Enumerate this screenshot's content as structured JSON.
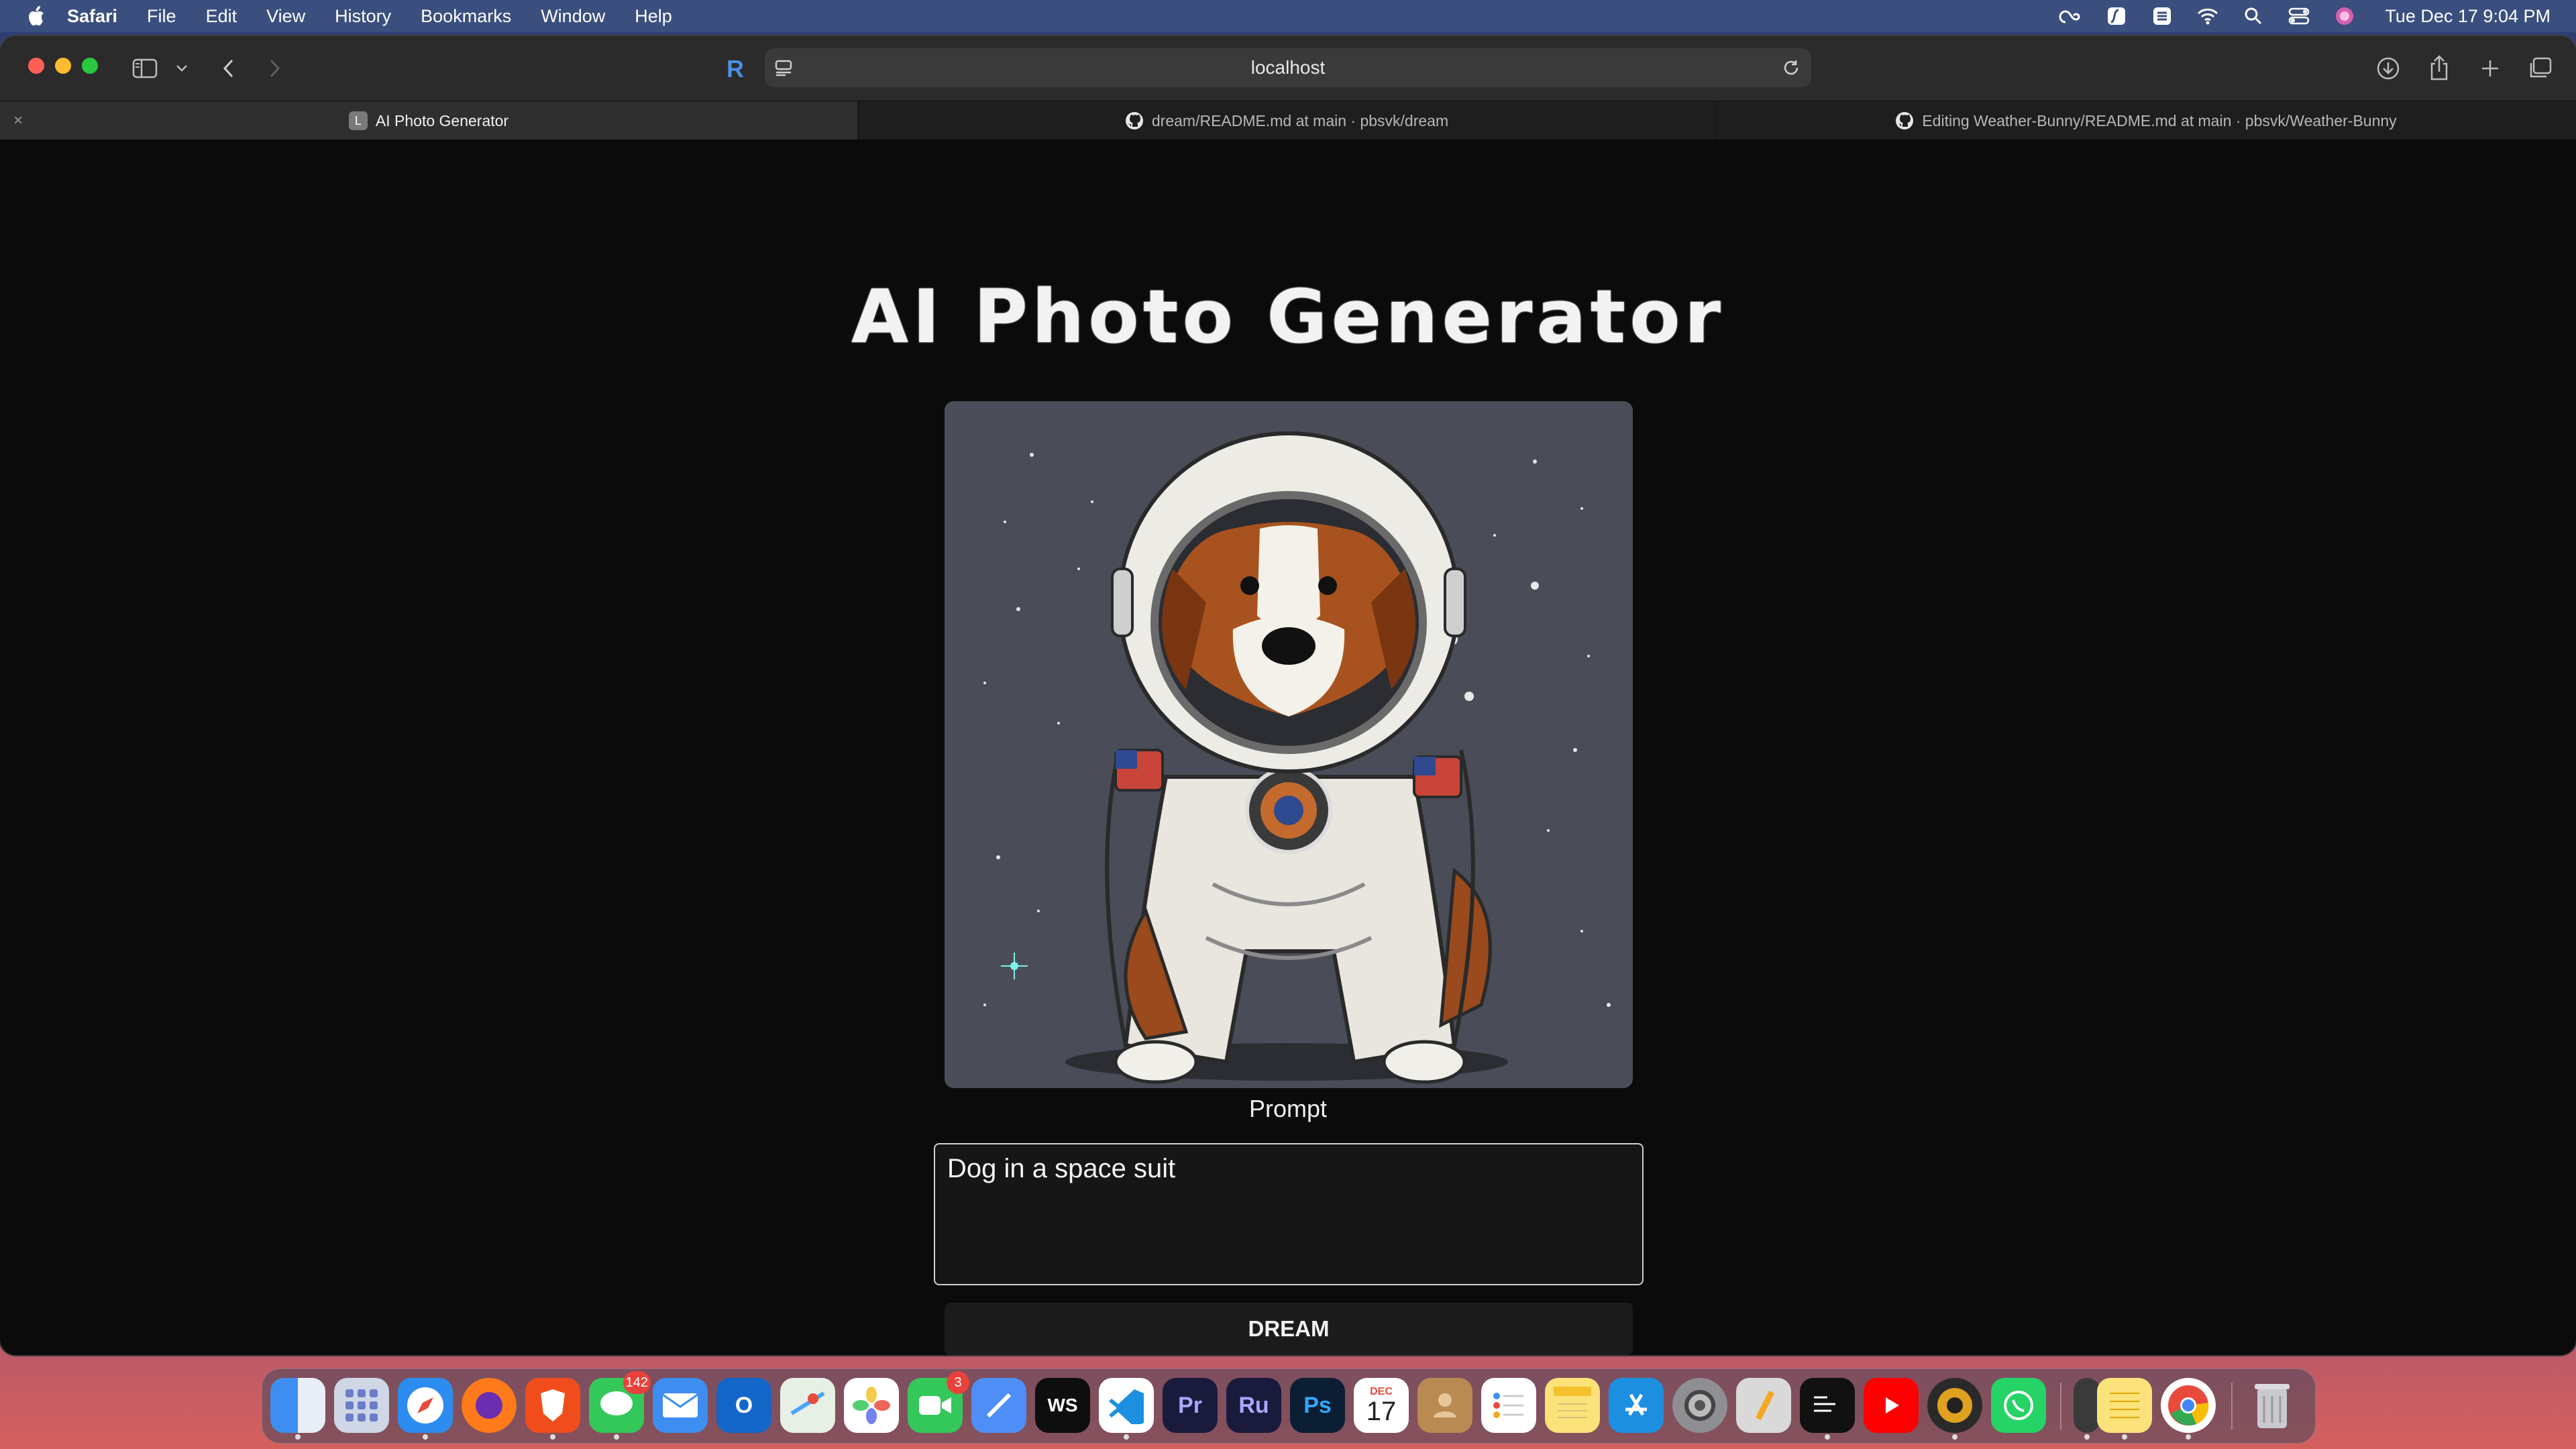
{
  "menubar": {
    "app_name": "Safari",
    "items": [
      "File",
      "Edit",
      "View",
      "History",
      "Bookmarks",
      "Window",
      "Help"
    ],
    "clock": "Tue Dec 17  9:04 PM"
  },
  "browser": {
    "url": "localhost",
    "tabs": [
      {
        "label": "AI Photo Generator",
        "active": true,
        "favicon_letter": "L"
      },
      {
        "label": "dream/README.md at main · pbsvk/dream",
        "active": false
      },
      {
        "label": "Editing Weather-Bunny/README.md at main · pbsvk/Weather-Bunny",
        "active": false
      }
    ]
  },
  "page": {
    "title": "AI Photo Generator",
    "prompt_label": "Prompt",
    "prompt_value": "Dog in a space suit",
    "button_label": "DREAM"
  },
  "dock": {
    "badges": {
      "messages": "142",
      "facetime": "3"
    },
    "calendar": {
      "month": "DEC",
      "day": "17"
    },
    "letters": {
      "webstorm": "WS",
      "premiere": "Pr",
      "rush": "Ru",
      "photoshop": "Ps"
    }
  },
  "colors": {
    "page_background": "#0b0b0b",
    "image_background": "#4b4e57",
    "accent": "#f2f2f2"
  }
}
